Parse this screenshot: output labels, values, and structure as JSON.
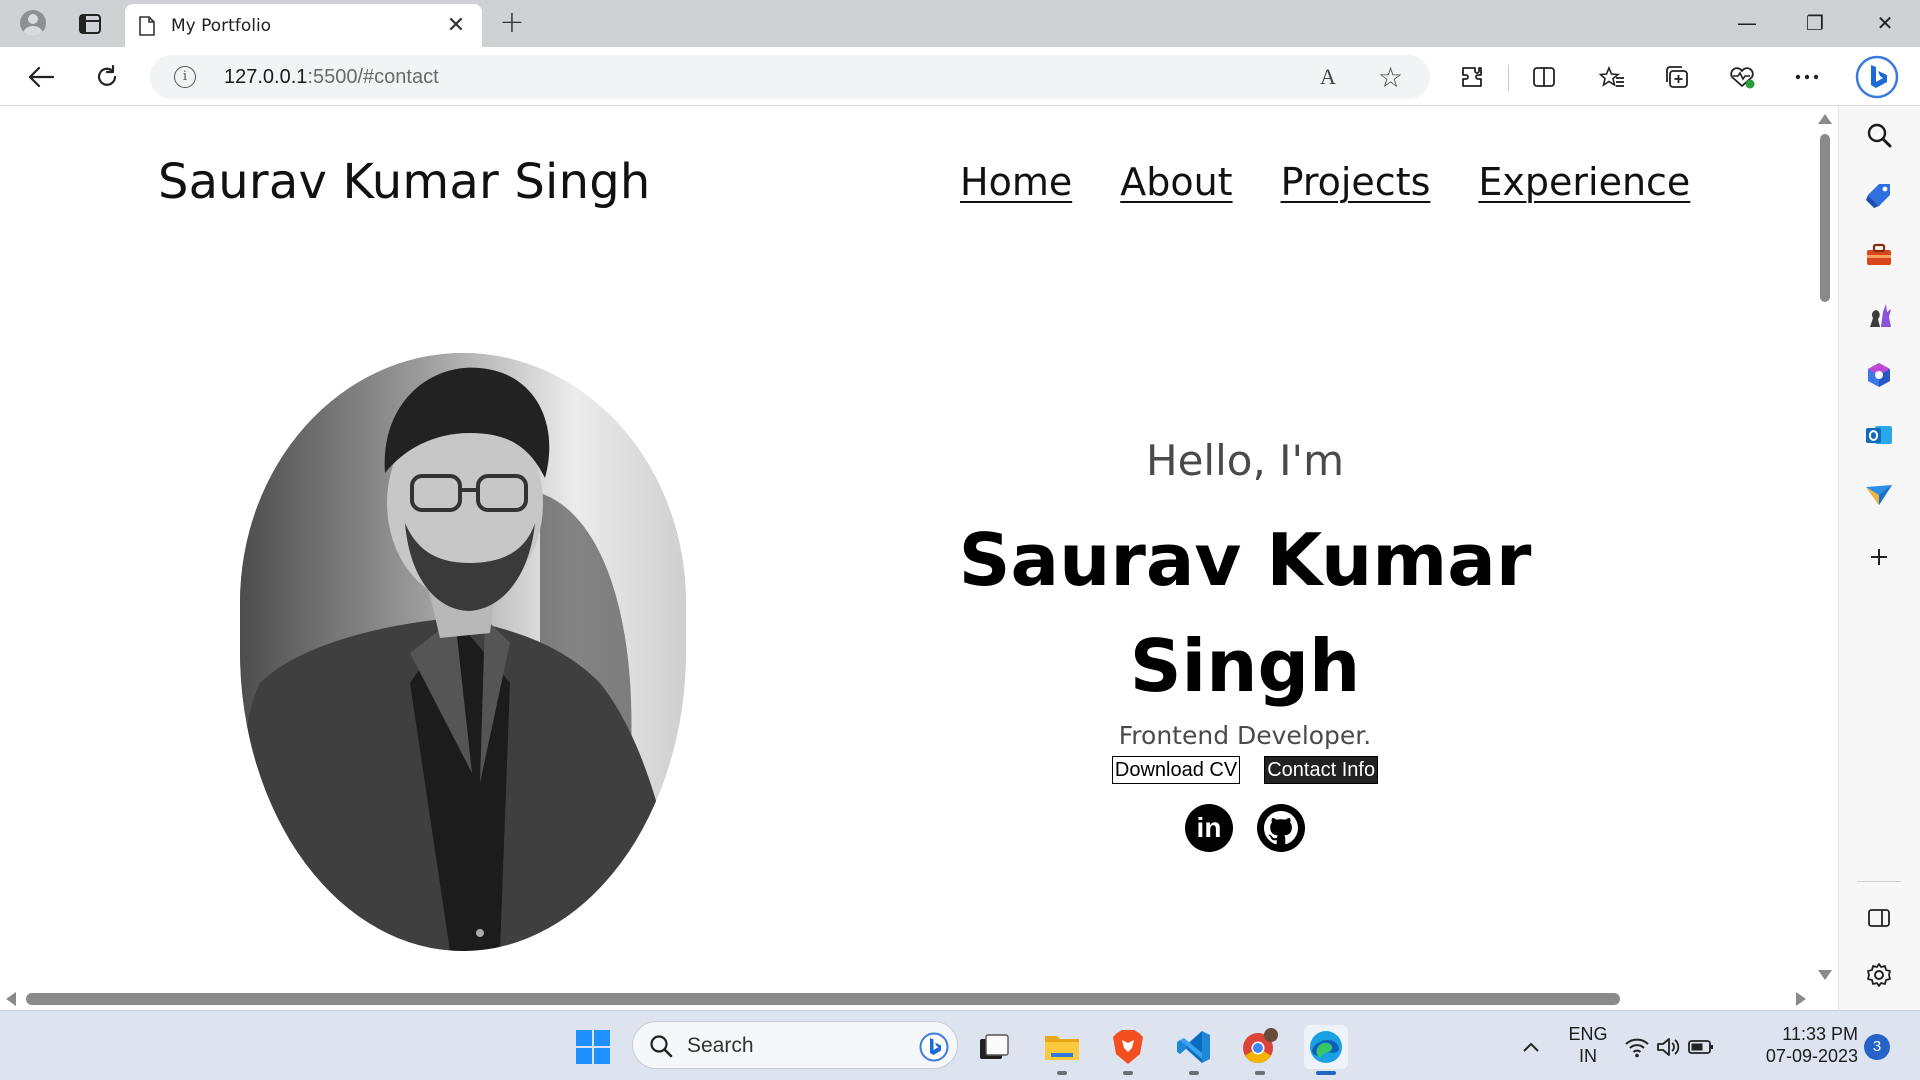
{
  "browser": {
    "tab_title": "My Portfolio",
    "tab_close": "✕",
    "new_tab": "+",
    "url_host": "127.0.0.1",
    "url_rest": ":5500/#contact",
    "read_aloud": "A",
    "window_controls": {
      "minimize": "—",
      "restore": "❐",
      "close": "✕"
    }
  },
  "page": {
    "brand": "Saurav Kumar Singh",
    "nav": [
      {
        "label": "Home"
      },
      {
        "label": "About"
      },
      {
        "label": "Projects"
      },
      {
        "label": "Experience"
      }
    ],
    "hero": {
      "greeting": "Hello, I'm",
      "name_line1": "Saurav Kumar",
      "name_line2": "Singh",
      "role": "Frontend Developer.",
      "download_cv": "Download CV",
      "contact_info": "Contact Info",
      "linkedin_text": "in"
    }
  },
  "taskbar": {
    "search_placeholder": "Search",
    "lang_line1": "ENG",
    "lang_line2": "IN",
    "time": "11:33 PM",
    "date": "07-09-2023",
    "notifications": "3"
  },
  "colors": {
    "chrome_tabbar": "#cfd1d4",
    "taskbar_bg": "#dde4f0",
    "accent": "#2563c8",
    "solid_button": "#222222"
  }
}
